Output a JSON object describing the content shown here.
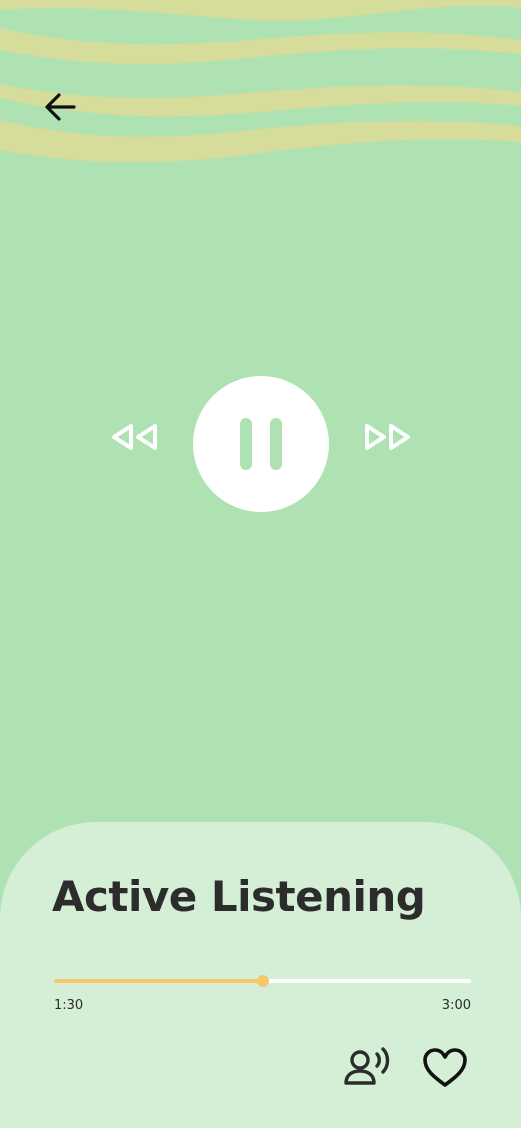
{
  "track": {
    "title": "Active Listening",
    "elapsed": "1:30",
    "duration": "3:00",
    "progress": 0.5
  },
  "player": {
    "state": "playing"
  },
  "colors": {
    "background": "#aee2b2",
    "wave": "#d6dc9a",
    "sheet": "#d5eed6",
    "accent": "#f5c96a",
    "text": "#2c2c2c"
  },
  "icons": {
    "back": "arrow-left-icon",
    "rewind": "rewind-icon",
    "play_pause": "pause-icon",
    "fast_forward": "fast-forward-icon",
    "voice": "voice-speaker-icon",
    "favorite": "heart-icon"
  }
}
